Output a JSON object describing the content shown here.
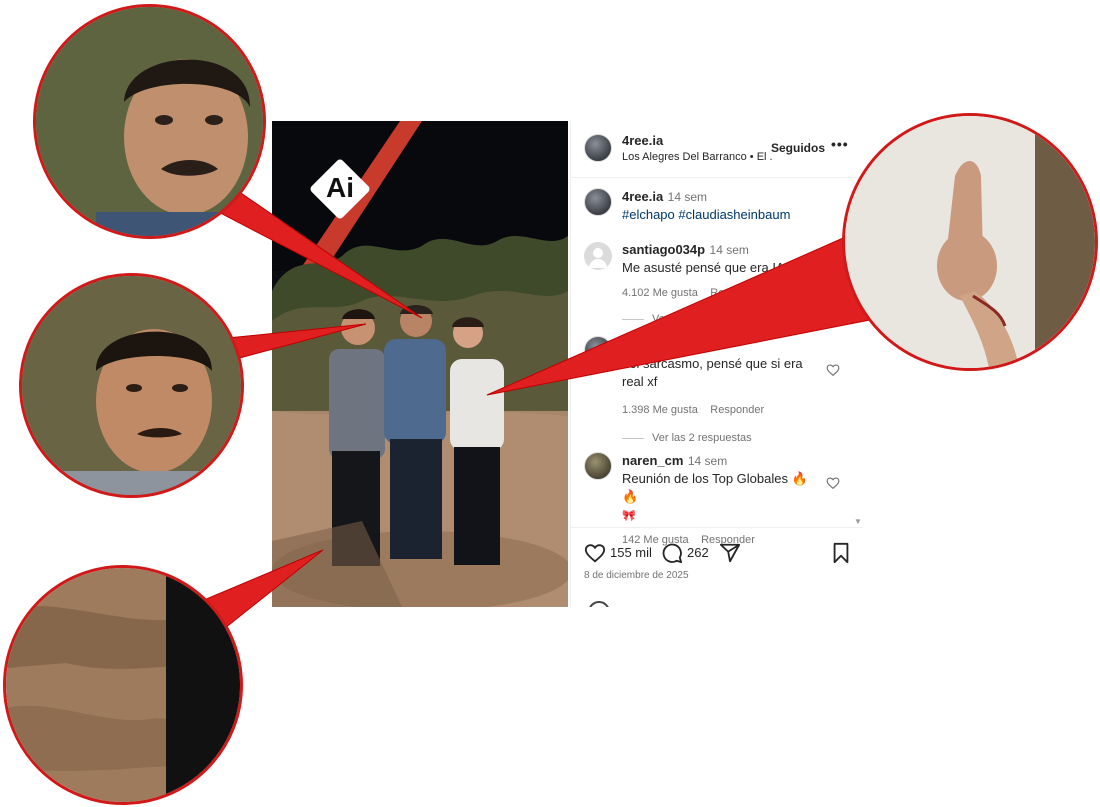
{
  "photo": {
    "badge": "Ai"
  },
  "post": {
    "username": "4ree.ia",
    "audio": "Los Alegres Del Barranco • El ...",
    "follow_label": "Seguidos",
    "more_icon": "more-icon",
    "caption": {
      "username": "4ree.ia",
      "time": "14 sem",
      "hashtags": "#elchapo #claudiasheinbaum"
    },
    "comments": [
      {
        "username": "santiago034p",
        "time": "14 sem",
        "text": "Me asusté pensé que era IA",
        "likes": "4.102 Me gusta",
        "reply": "Respo",
        "view_replies": "Ver"
      },
      {
        "username": "",
        "time": "",
        "text": "del sarcasmo, pensé que si era real xf",
        "likes": "1.398 Me gusta",
        "reply": "Responder",
        "view_replies": "Ver las 2 respuestas"
      },
      {
        "username": "naren_cm",
        "time": "14 sem",
        "text": "Reunión de los Top Globales 🔥 🔥",
        "likes": "142 Me gusta",
        "reply": "Responder"
      }
    ],
    "actions": {
      "likes": "155 mil",
      "comments": "262"
    },
    "date": "8 de diciembre de 2025"
  },
  "colors": {
    "callout_red": "#e02020",
    "link": "#00376b",
    "muted": "#737373"
  }
}
